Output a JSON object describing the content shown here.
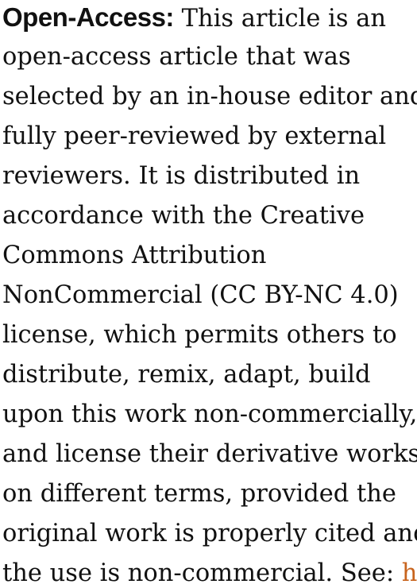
{
  "notice": {
    "label": "Open-Access:",
    "lines": [
      " This article is an",
      "open-access article that was",
      "selected by an in-house editor and",
      "fully peer-reviewed by external",
      "reviewers. It is distributed in",
      "accordance with the Creative",
      "Commons Attribution",
      "NonCommercial (CC BY-NC 4.0)",
      "license, which permits others to",
      "distribute, remix, adapt, build",
      "upon this work non-commercially,",
      "and license their derivative works",
      "on different terms, provided the",
      "original work is properly cited and",
      "the use is non-commercial. See: "
    ],
    "link_text": "htt"
  },
  "colors": {
    "text": "#111111",
    "link": "#c8641e",
    "background": "#ffffff"
  }
}
